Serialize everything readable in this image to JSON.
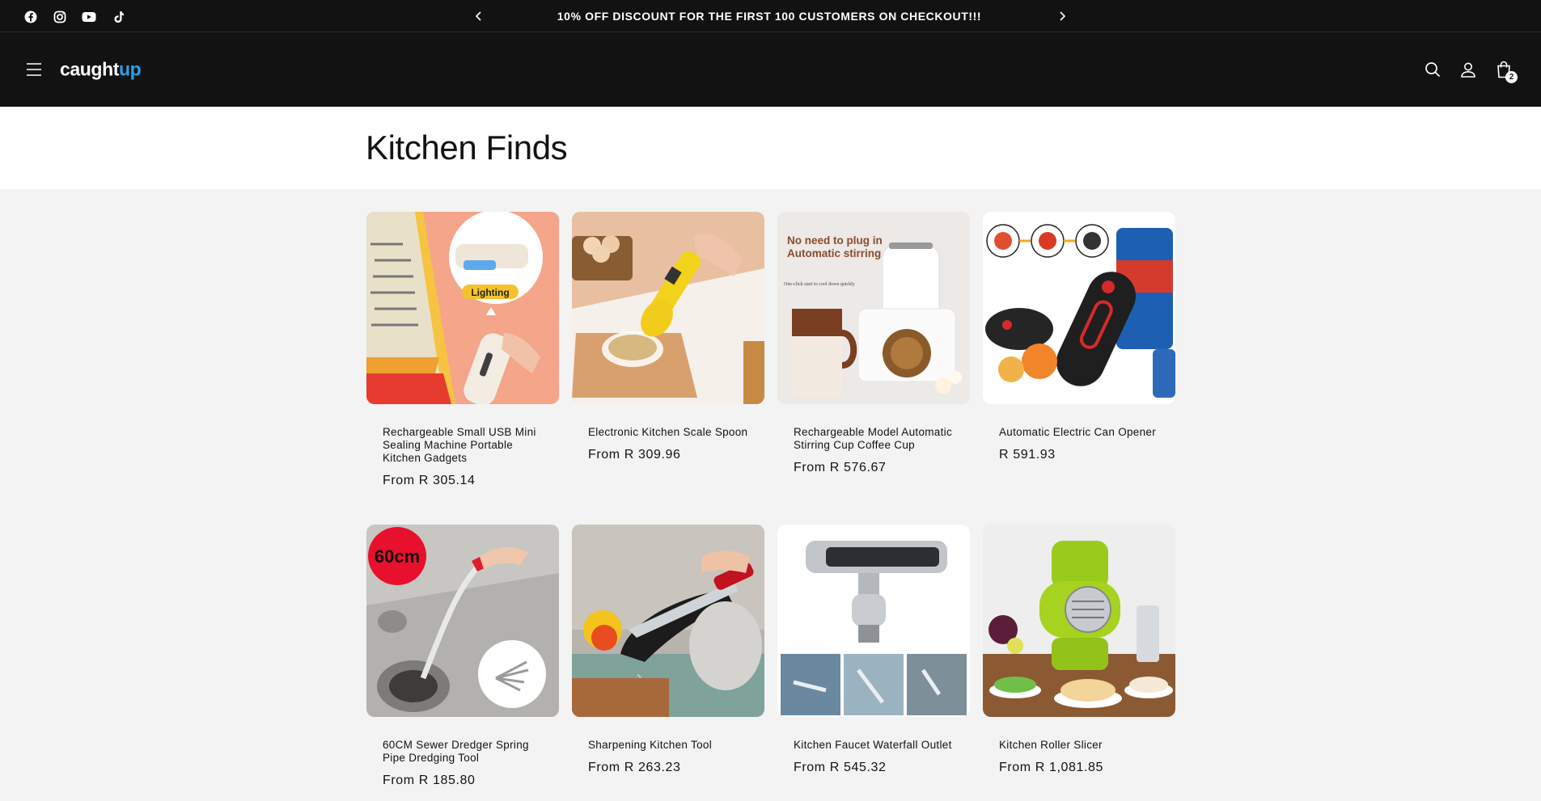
{
  "announcement": {
    "message": "10% OFF DISCOUNT FOR THE FIRST 100 CUSTOMERS ON CHECKOUT!!!",
    "socials": [
      "facebook-icon",
      "instagram-icon",
      "youtube-icon",
      "tiktok-icon"
    ]
  },
  "header": {
    "logo_part1": "caught",
    "logo_part2": "up",
    "cart_count": "2",
    "icons": [
      "menu-icon",
      "search-icon",
      "account-icon",
      "cart-icon"
    ],
    "colors": {
      "background": "#121212",
      "logo_accent": "#2f9ee9"
    }
  },
  "collection": {
    "title": "Kitchen Finds",
    "products": [
      {
        "title": "Rechargeable Small USB Mini Sealing Machine Portable Kitchen Gadgets",
        "price": "From R 305.14"
      },
      {
        "title": "Electronic Kitchen Scale Spoon",
        "price": "From R 309.96"
      },
      {
        "title": "Rechargeable Model Automatic Stirring Cup Coffee Cup",
        "price": "From R 576.67"
      },
      {
        "title": "Automatic Electric Can Opener",
        "price": "R 591.93"
      },
      {
        "title": "60CM Sewer Dredger Spring Pipe Dredging Tool",
        "price": "From R 185.80"
      },
      {
        "title": "Sharpening Kitchen Tool",
        "price": "From R 263.23"
      },
      {
        "title": "Kitchen Faucet Waterfall Outlet",
        "price": "From R 545.32"
      },
      {
        "title": "Kitchen Roller Slicer",
        "price": "From R 1,081.85"
      }
    ],
    "image_text": {
      "sealer_badge": "Lighting",
      "cup_headline_1": "No need to plug in",
      "cup_headline_2": "Automatic stirring",
      "cup_subline": "One-click start to cool down quickly",
      "dredger_badge": "60cm"
    }
  }
}
